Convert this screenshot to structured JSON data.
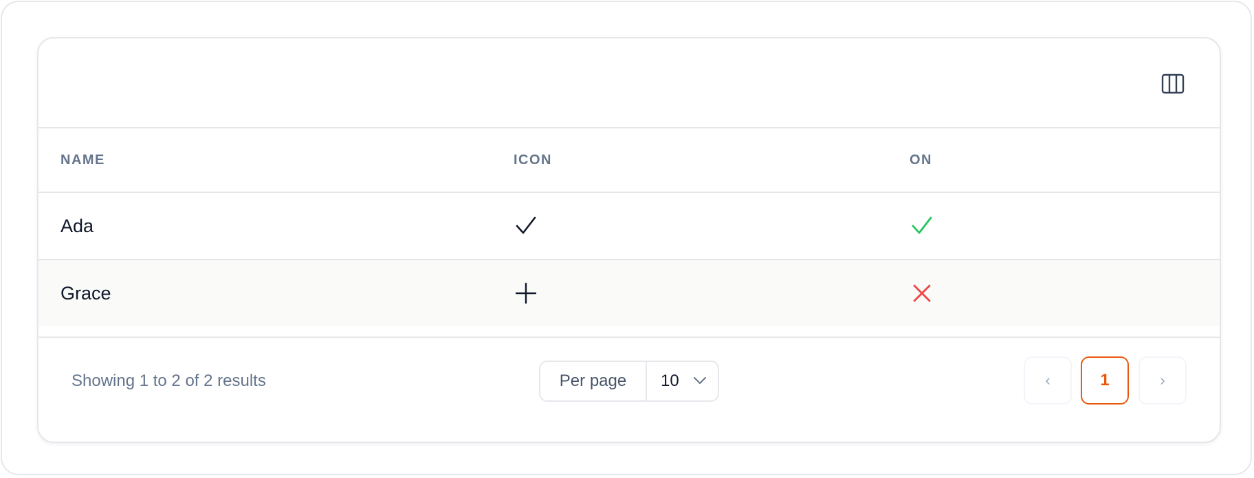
{
  "toolbar": {
    "column_toggle_icon": "columns-icon"
  },
  "table": {
    "headers": [
      "NAME",
      "ICON",
      "ON"
    ],
    "rows": [
      {
        "name": "Ada",
        "icon": "check-icon",
        "on": true
      },
      {
        "name": "Grace",
        "icon": "plus-icon",
        "on": false
      }
    ]
  },
  "colors": {
    "accent": "#ea580c",
    "true": "#22c55e",
    "false": "#ef4444",
    "muted": "#64748b"
  },
  "footer": {
    "results_text": "Showing 1 to 2 of 2 results",
    "per_page_label": "Per page",
    "per_page_value": "10",
    "prev_label": "‹",
    "current_page": "1",
    "next_label": "›"
  }
}
